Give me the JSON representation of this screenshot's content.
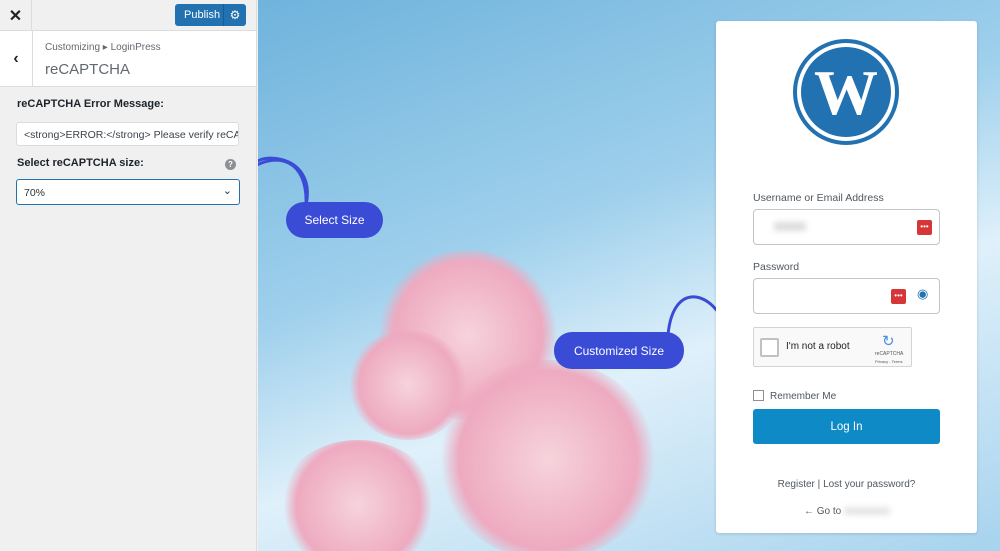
{
  "sidebar": {
    "close_icon": "close-icon",
    "publish_label": "Publish",
    "breadcrumb": "Customizing ▸ LoginPress",
    "section_title": "reCAPTCHA",
    "error_label": "reCAPTCHA Error Message:",
    "error_value": "<strong>ERROR:</strong> Please verify reCAPTCHA",
    "size_label": "Select reCAPTCHA size:",
    "size_value": "70%"
  },
  "annotations": {
    "select_size": "Select Size",
    "customized_size": "Customized Size",
    "color": "#3a4bd6"
  },
  "login": {
    "username_label": "Username or Email Address",
    "password_label": "Password",
    "captcha_text": "I'm not a robot",
    "captcha_brand": "reCAPTCHA",
    "captcha_links": "Privacy - Terms",
    "remember": "Remember Me",
    "login_button": "Log In",
    "register": "Register",
    "sep": "|",
    "lost": "Lost your password?",
    "goto": "← Go to",
    "accent": "#0e8ac6"
  }
}
